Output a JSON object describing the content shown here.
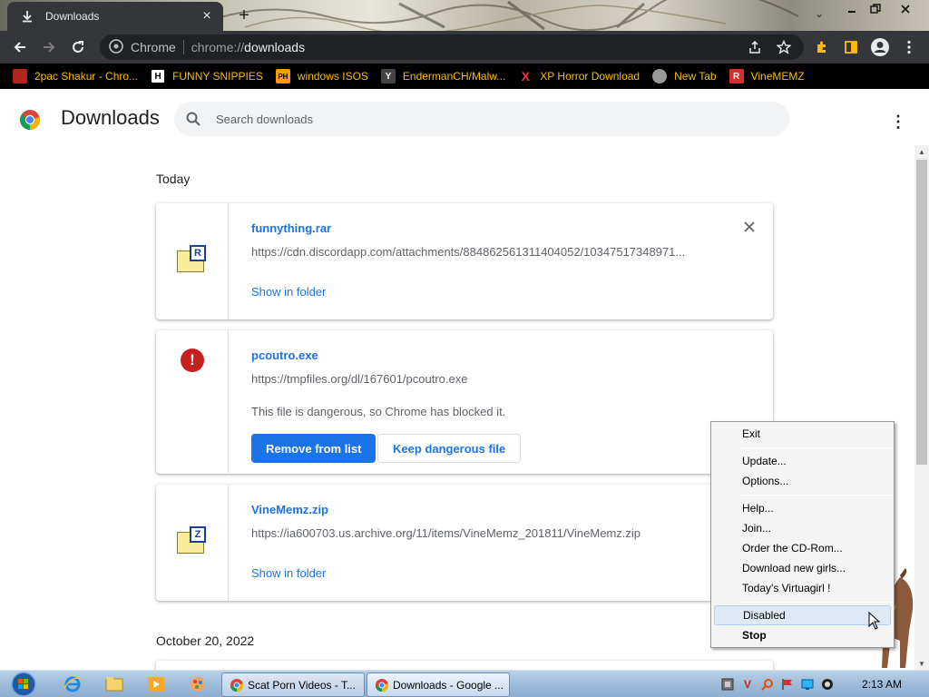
{
  "window": {
    "tab_title": "Downloads",
    "tab_close": "×",
    "new_tab": "+"
  },
  "toolbar": {
    "omnibox_chip": "Chrome",
    "url_scheme": "chrome://",
    "url_path": "downloads"
  },
  "bookmarks": [
    {
      "label": "2pac Shakur - Chro...",
      "icon": "bookmark-2pac-icon",
      "color": "#b3261e"
    },
    {
      "label": "FUNNY SNIPPIES",
      "icon": "bookmark-h-icon",
      "glyph": "H",
      "color": "#ffffff"
    },
    {
      "label": "windows ISOS",
      "icon": "bookmark-ph-icon",
      "glyph": "PH",
      "color": "#ff9900"
    },
    {
      "label": "EndermanCH/Malw...",
      "icon": "bookmark-yp-icon",
      "glyph": "Y",
      "color": "#444444"
    },
    {
      "label": "XP Horror Download",
      "icon": "bookmark-x-icon",
      "glyph": "X",
      "color": "#e53935"
    },
    {
      "label": "New Tab",
      "icon": "bookmark-newtab-icon",
      "color": "#999999"
    },
    {
      "label": "VineMEMZ",
      "icon": "bookmark-r-icon",
      "glyph": "R",
      "color": "#d32f2f"
    }
  ],
  "page": {
    "title": "Downloads",
    "search_placeholder": "Search downloads",
    "more": "⋮"
  },
  "sections": [
    {
      "date": "Today"
    },
    {
      "date": "October 20, 2022"
    }
  ],
  "downloads": [
    {
      "filename": "funnything.rar",
      "url": "https://cdn.discordapp.com/attachments/884862561311404052/10347517348971...",
      "action": "Show in folder",
      "icon": "rar-file-icon",
      "tag": "R"
    },
    {
      "filename": "pcoutro.exe",
      "url": "https://tmpfiles.org/dl/167601/pcoutro.exe",
      "warning": "This file is dangerous, so Chrome has blocked it.",
      "primary_button": "Remove from list",
      "secondary_button": "Keep dangerous file",
      "icon": "danger-icon",
      "glyph": "!"
    },
    {
      "filename": "VineMemz.zip",
      "url": "https://ia600703.us.archive.org/11/items/VineMemz_201811/VineMemz.zip",
      "action": "Show in folder",
      "icon": "zip-file-icon",
      "tag": "Z"
    }
  ],
  "context_menu": {
    "items": [
      {
        "label": "Exit"
      },
      {
        "label": "Update..."
      },
      {
        "label": "Options..."
      },
      {
        "label": "Help..."
      },
      {
        "label": "Join..."
      },
      {
        "label": "Order the CD-Rom..."
      },
      {
        "label": "Download new girls..."
      },
      {
        "label": "Today's Virtuagirl !"
      },
      {
        "label": "Disabled",
        "highlighted": true
      },
      {
        "label": "Stop",
        "bold": true
      }
    ]
  },
  "taskbar": {
    "tasks": [
      {
        "label": "Scat Porn Videos - T...",
        "active": false
      },
      {
        "label": "Downloads - Google ...",
        "active": true
      }
    ],
    "clock": "2:13 AM"
  },
  "colors": {
    "accent": "#1a73e8",
    "danger": "#c5221f",
    "bookmark_text": "#fbbc04",
    "toolbar_bg": "#35363a"
  }
}
